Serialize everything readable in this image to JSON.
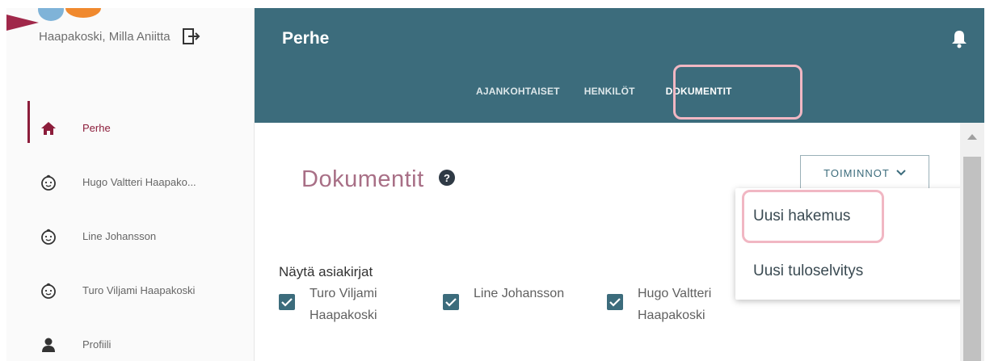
{
  "sidebar": {
    "user_name": "Haapakoski, Milla Aniitta",
    "items": [
      {
        "label": "Perhe",
        "icon": "home-icon",
        "active": true
      },
      {
        "label": "Hugo Valtteri Haapako...",
        "icon": "child-face-icon"
      },
      {
        "label": "Line Johansson",
        "icon": "child-face-icon"
      },
      {
        "label": "Turo Viljami Haapakoski",
        "icon": "child-face-icon"
      },
      {
        "label": "Profiili",
        "icon": "person-icon"
      }
    ]
  },
  "header": {
    "title": "Perhe",
    "tabs": [
      "AJANKOHTAISET",
      "HENKILÖT",
      "DOKUMENTIT"
    ],
    "active_tab": "DOKUMENTIT"
  },
  "main": {
    "page_title": "Dokumentit",
    "help": "?",
    "actions_label": "TOIMINNOT",
    "menu": [
      "Uusi hakemus",
      "Uusi tuloselvitys"
    ],
    "show_documents_label": "Näytä asiakirjat",
    "filters": [
      {
        "line1": "Turo Viljami",
        "line2": "Haapakoski",
        "checked": true
      },
      {
        "line1": "Line Johansson",
        "line2": "",
        "checked": true
      },
      {
        "line1": "Hugo Valtteri",
        "line2": "Haapakoski",
        "checked": true
      }
    ]
  },
  "colors": {
    "header_bg": "#3c6c7c",
    "accent": "#8c1d3b",
    "title_pink": "#a86f86",
    "highlight": "#f1b7c3"
  }
}
